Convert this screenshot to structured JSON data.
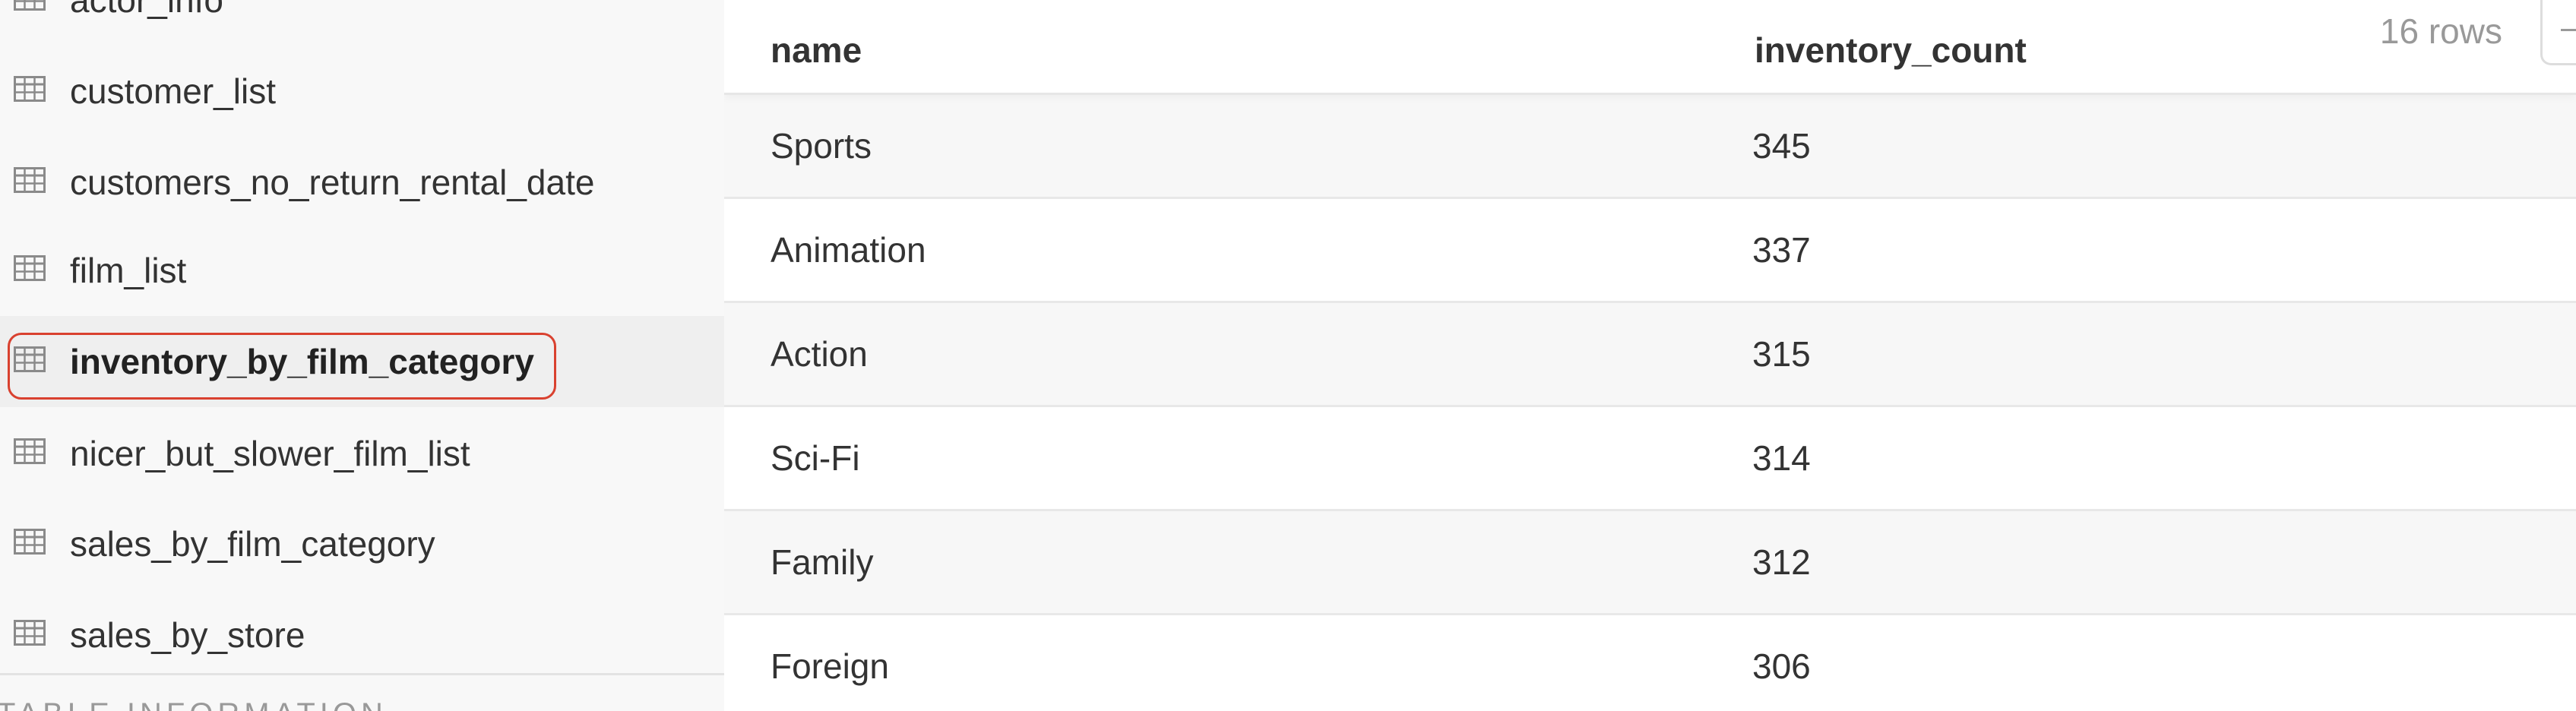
{
  "sidebar": {
    "items": [
      {
        "label": "actor_info"
      },
      {
        "label": "customer_list"
      },
      {
        "label": "customers_no_return_rental_date"
      },
      {
        "label": "film_list"
      },
      {
        "label": "inventory_by_film_category",
        "selected": true
      },
      {
        "label": "nicer_but_slower_film_list"
      },
      {
        "label": "sales_by_film_category"
      },
      {
        "label": "sales_by_store"
      }
    ],
    "section_heading": "TABLE INFORMATION",
    "icon": "table-grid-icon"
  },
  "table": {
    "row_count": "16 rows",
    "columns": [
      "name",
      "inventory_count"
    ],
    "rows": [
      {
        "name": "Sports",
        "inventory_count": "345"
      },
      {
        "name": "Animation",
        "inventory_count": "337"
      },
      {
        "name": "Action",
        "inventory_count": "315"
      },
      {
        "name": "Sci-Fi",
        "inventory_count": "314"
      },
      {
        "name": "Family",
        "inventory_count": "312"
      },
      {
        "name": "Foreign",
        "inventory_count": "306"
      }
    ]
  },
  "colors": {
    "selection_ring": "#d9412f",
    "sidebar_bg": "#f8f8f8",
    "stripe": "#f7f7f7"
  }
}
